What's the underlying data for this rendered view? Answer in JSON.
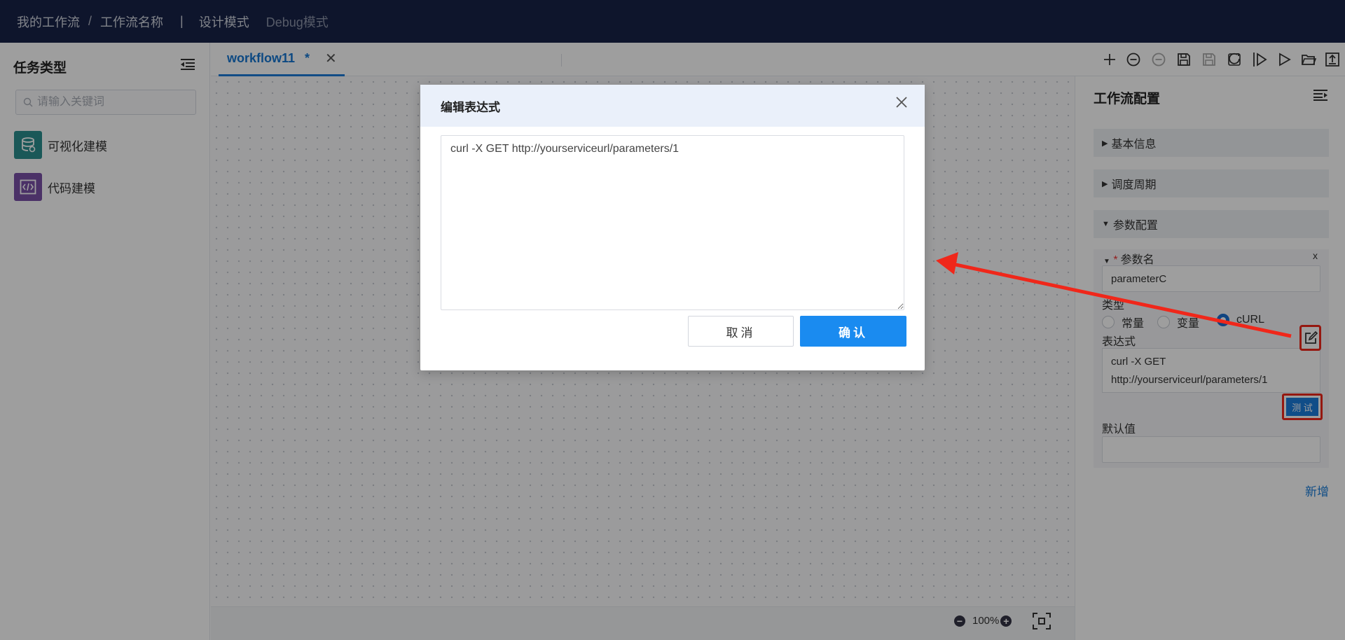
{
  "topbar": {
    "crumb1": "我的工作流",
    "crumb_sep": "/",
    "crumb2": "工作流名称",
    "divider": "|",
    "mode_design": "设计模式",
    "mode_debug": "Debug模式"
  },
  "left_panel": {
    "title": "任务类型",
    "search_placeholder": "请输入关键词",
    "items": [
      {
        "label": "可视化建模",
        "icon": "database-icon",
        "color": "#2b8f8f"
      },
      {
        "label": "代码建模",
        "icon": "code-icon",
        "color": "#7a4fa6"
      }
    ]
  },
  "canvas": {
    "tab_label": "workflow11",
    "tab_modified": "*",
    "tab_close": "✕",
    "zoom_level": "100%",
    "zoom_out": "−",
    "zoom_in": "+"
  },
  "toolbar": {
    "tools": [
      "add-icon",
      "zoom-out-icon",
      "zoom-out-disabled-icon",
      "save-icon",
      "save-as-disabled-icon",
      "refresh-icon",
      "run-icon",
      "run-step-icon",
      "open-folder-icon",
      "export-icon"
    ]
  },
  "right_panel": {
    "title": "工作流配置",
    "sections": [
      "基本信息",
      "调度周期",
      "参数配置"
    ],
    "param": {
      "name_label": "参数名",
      "required_mark": "*",
      "remove": "x",
      "name_value": "parameterC",
      "type_label": "类型",
      "type_options": [
        "常量",
        "变量",
        "cURL"
      ],
      "type_selected": "cURL",
      "expr_label": "表达式",
      "expr_value": "curl -X GET http://yourserviceurl/parameters/1",
      "test_button": "测 试",
      "default_label": "默认值",
      "default_value": ""
    },
    "add_link": "新增"
  },
  "dialog": {
    "title": "编辑表达式",
    "expression": "curl -X GET http://yourserviceurl/parameters/1",
    "cancel_label": "取消",
    "confirm_label": "确认"
  },
  "colors": {
    "topbar": "#182348",
    "accent": "#1a8bf0",
    "highlight": "#f0271a"
  }
}
